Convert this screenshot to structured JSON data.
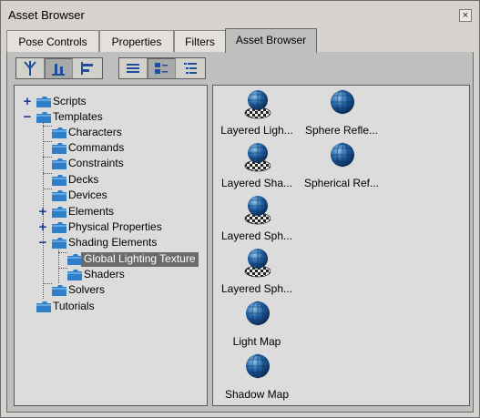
{
  "window": {
    "title": "Asset Browser",
    "close_glyph": "×"
  },
  "tabs": [
    "Pose Controls",
    "Properties",
    "Filters",
    "Asset Browser"
  ],
  "active_tab": "Asset Browser",
  "toolbar": {
    "view_group": [
      {
        "name": "tree-view-icon",
        "pressed": false
      },
      {
        "name": "bottom-align-icon",
        "pressed": true
      },
      {
        "name": "left-align-icon",
        "pressed": false
      }
    ],
    "display_group": [
      {
        "name": "list-view-icon",
        "pressed": false
      },
      {
        "name": "icon-view-icon",
        "pressed": true
      },
      {
        "name": "detail-view-icon",
        "pressed": false
      }
    ]
  },
  "tree": [
    {
      "label": "Scripts",
      "expander": "+"
    },
    {
      "label": "Templates",
      "expander": "−"
    },
    {
      "label": "Characters"
    },
    {
      "label": "Commands"
    },
    {
      "label": "Constraints"
    },
    {
      "label": "Decks"
    },
    {
      "label": "Devices"
    },
    {
      "label": "Elements",
      "expander": "+"
    },
    {
      "label": "Physical Properties",
      "expander": "+"
    },
    {
      "label": "Shading Elements",
      "expander": "−"
    },
    {
      "label": "Global Lighting Texture",
      "selected": true
    },
    {
      "label": "Shaders"
    },
    {
      "label": "Solvers"
    },
    {
      "label": "Tutorials"
    }
  ],
  "assets": [
    {
      "label": "Layered Ligh...",
      "icon": "layered-sphere-icon"
    },
    {
      "label": "Sphere Refle...",
      "icon": "sphere-icon"
    },
    {
      "label": "Layered Sha...",
      "icon": "layered-sphere-icon"
    },
    {
      "label": "Spherical Ref...",
      "icon": "sphere-icon"
    },
    {
      "label": "Layered Sph...",
      "icon": "layered-sphere-icon"
    },
    {
      "label": "Layered Sph...",
      "icon": "layered-sphere-icon"
    },
    {
      "label": "Light Map",
      "icon": "sphere-icon"
    },
    {
      "label": "Shadow Map",
      "icon": "sphere-icon"
    }
  ],
  "colors": {
    "selection": "#6b6b6b",
    "sphere": "#1f5fa0",
    "folder": "#2f7fc8"
  }
}
